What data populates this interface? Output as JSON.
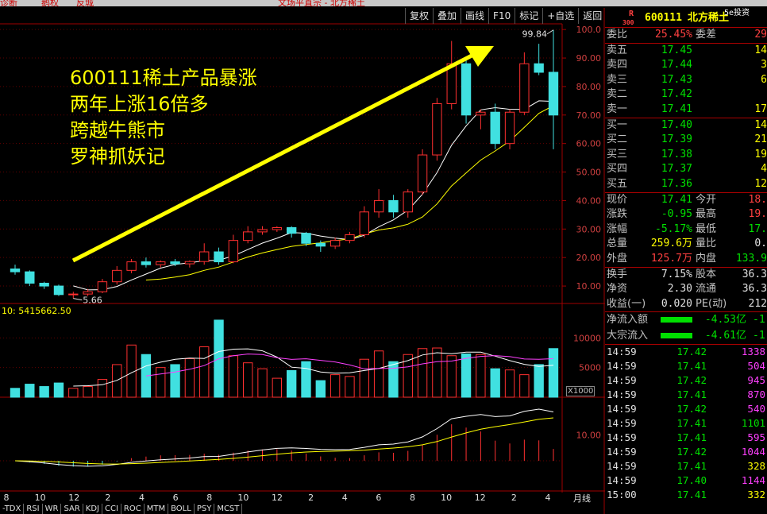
{
  "top_strip": {
    "items": [
      "诊断",
      "鹅权",
      "反城",
      "文场平直宗 - 北方稀土"
    ]
  },
  "toolbar": [
    "复权",
    "叠加",
    "画线",
    "F10",
    "标记",
    "+自选",
    "返回"
  ],
  "headline": [
    "600111稀土产品暴涨",
    "两年上涨16倍多",
    "跨越牛熊市",
    "罗神抓妖记"
  ],
  "price_axis": [
    "100.0",
    "90.00",
    "80.00",
    "70.00",
    "60.00",
    "50.00",
    "40.00",
    "30.00",
    "20.00",
    "10.00"
  ],
  "annotations": {
    "high": "99.84",
    "low": "5.66"
  },
  "volume": {
    "label": "10: 5415662.50",
    "ticks": [
      "10000",
      "5000"
    ],
    "multiplier": "X1000"
  },
  "indicator_ticks": [
    "10.00"
  ],
  "x_ticks": [
    "8",
    "10",
    "12",
    "2",
    "4",
    "6",
    "8",
    "10",
    "12",
    "2",
    "4",
    "6",
    "8",
    "10",
    "12",
    "2",
    "4"
  ],
  "period": "月线",
  "bottom_tabs": [
    "-TDX",
    "RSI",
    "WR",
    "SAR",
    "KDJ",
    "CCI",
    "ROC",
    "MTM",
    "BOLL",
    "PSY",
    "MCST"
  ],
  "stock": {
    "code": "600111",
    "name": "北方稀土",
    "badge_top": "R",
    "badge_bottom": "300",
    "logo": "5e投资"
  },
  "weibi": {
    "label": "委比",
    "value": "25.45%",
    "label2": "委差",
    "value2": "29"
  },
  "asks": [
    {
      "label": "卖五",
      "price": "17.45",
      "vol": "14"
    },
    {
      "label": "卖四",
      "price": "17.44",
      "vol": "3"
    },
    {
      "label": "卖三",
      "price": "17.43",
      "vol": "6"
    },
    {
      "label": "卖二",
      "price": "17.42",
      "vol": ""
    },
    {
      "label": "卖一",
      "price": "17.41",
      "vol": "17"
    }
  ],
  "bids": [
    {
      "label": "买一",
      "price": "17.40",
      "vol": "14"
    },
    {
      "label": "买二",
      "price": "17.39",
      "vol": "21"
    },
    {
      "label": "买三",
      "price": "17.38",
      "vol": "19"
    },
    {
      "label": "买四",
      "price": "17.37",
      "vol": "4"
    },
    {
      "label": "买五",
      "price": "17.36",
      "vol": "12"
    }
  ],
  "quote": [
    {
      "l1": "现价",
      "v1": "17.41",
      "c1": "g",
      "l2": "今开",
      "v2": "18.",
      "c2": "r"
    },
    {
      "l1": "涨跌",
      "v1": "-0.95",
      "c1": "g",
      "l2": "最高",
      "v2": "19.",
      "c2": "r"
    },
    {
      "l1": "涨幅",
      "v1": "-5.17%",
      "c1": "g",
      "l2": "最低",
      "v2": "17.",
      "c2": "g"
    },
    {
      "l1": "总量",
      "v1": "259.6万",
      "c1": "y",
      "l2": "量比",
      "v2": "0.",
      "c2": "w"
    },
    {
      "l1": "外盘",
      "v1": "125.7万",
      "c1": "r",
      "l2": "内盘",
      "v2": "133.9",
      "c2": "g"
    }
  ],
  "stats": [
    {
      "l1": "换手",
      "v1": "7.15%",
      "l2": "股本",
      "v2": "36.3"
    },
    {
      "l1": "净资",
      "v1": "2.30",
      "l2": "流通",
      "v2": "36.3"
    },
    {
      "l1": "收益(一)",
      "v1": "0.020",
      "l2": "PE(动)",
      "v2": "212"
    }
  ],
  "flows": [
    {
      "label": "净流入额",
      "value": "-4.53亿",
      "extra": "-1("
    },
    {
      "label": "大宗流入",
      "value": "-4.61亿",
      "extra": "-1("
    }
  ],
  "ticks": [
    {
      "time": "14:59",
      "price": "17.42",
      "vol": "1338",
      "c": "m"
    },
    {
      "time": "14:59",
      "price": "17.41",
      "vol": "504",
      "c": "m"
    },
    {
      "time": "14:59",
      "price": "17.42",
      "vol": "945",
      "c": "m"
    },
    {
      "time": "14:59",
      "price": "17.41",
      "vol": "870",
      "c": "m"
    },
    {
      "time": "14:59",
      "price": "17.42",
      "vol": "540",
      "c": "m"
    },
    {
      "time": "14:59",
      "price": "17.41",
      "vol": "1101",
      "c": "g"
    },
    {
      "time": "14:59",
      "price": "17.41",
      "vol": "595",
      "c": "m"
    },
    {
      "time": "14:59",
      "price": "17.42",
      "vol": "1044",
      "c": "m"
    },
    {
      "time": "14:59",
      "price": "17.41",
      "vol": "328",
      "c": "y"
    },
    {
      "time": "14:59",
      "price": "17.40",
      "vol": "1144",
      "c": "m"
    },
    {
      "time": "15:00",
      "price": "17.41",
      "vol": "332",
      "c": "y"
    }
  ],
  "colors": {
    "up": "#ff3030",
    "down": "#40e0e0",
    "ma5": "#ffffff",
    "ma10": "#ffff00",
    "arrow": "#ffff00"
  },
  "chart_data": {
    "type": "candlestick",
    "period": "月线",
    "candles": [
      {
        "o": 16,
        "h": 17.5,
        "l": 14,
        "c": 15
      },
      {
        "o": 15,
        "h": 15.5,
        "l": 10,
        "c": 11
      },
      {
        "o": 11,
        "h": 11.5,
        "l": 9,
        "c": 10
      },
      {
        "o": 10,
        "h": 10.5,
        "l": 6.5,
        "c": 7
      },
      {
        "o": 7,
        "h": 8,
        "l": 5.66,
        "c": 7.2
      },
      {
        "o": 7.2,
        "h": 9,
        "l": 6.5,
        "c": 8
      },
      {
        "o": 8,
        "h": 12.5,
        "l": 7.5,
        "c": 11.5
      },
      {
        "o": 11.5,
        "h": 17,
        "l": 10.5,
        "c": 15.5
      },
      {
        "o": 15.5,
        "h": 19.5,
        "l": 14.5,
        "c": 18.5
      },
      {
        "o": 18.5,
        "h": 20,
        "l": 16.5,
        "c": 17.5
      },
      {
        "o": 17.5,
        "h": 19,
        "l": 16.5,
        "c": 18.5
      },
      {
        "o": 18.5,
        "h": 19.5,
        "l": 17,
        "c": 17.8
      },
      {
        "o": 17.8,
        "h": 19,
        "l": 16.5,
        "c": 18.6
      },
      {
        "o": 18.6,
        "h": 25,
        "l": 17.5,
        "c": 22
      },
      {
        "o": 22,
        "h": 23.5,
        "l": 17.5,
        "c": 18.5
      },
      {
        "o": 18.5,
        "h": 28,
        "l": 18,
        "c": 26
      },
      {
        "o": 26,
        "h": 31,
        "l": 25,
        "c": 29
      },
      {
        "o": 29,
        "h": 31,
        "l": 28,
        "c": 29.8
      },
      {
        "o": 29.8,
        "h": 31,
        "l": 29,
        "c": 30.5
      },
      {
        "o": 30.5,
        "h": 31,
        "l": 27,
        "c": 28.5
      },
      {
        "o": 28.5,
        "h": 29,
        "l": 24,
        "c": 25
      },
      {
        "o": 25,
        "h": 26,
        "l": 22,
        "c": 24
      },
      {
        "o": 24,
        "h": 27,
        "l": 23,
        "c": 26
      },
      {
        "o": 26,
        "h": 29,
        "l": 25,
        "c": 28
      },
      {
        "o": 28,
        "h": 38,
        "l": 27,
        "c": 36
      },
      {
        "o": 36,
        "h": 44,
        "l": 34,
        "c": 40
      },
      {
        "o": 40,
        "h": 42,
        "l": 34,
        "c": 36
      },
      {
        "o": 36,
        "h": 44,
        "l": 34,
        "c": 43
      },
      {
        "o": 43,
        "h": 58,
        "l": 42,
        "c": 56
      },
      {
        "o": 56,
        "h": 76,
        "l": 54,
        "c": 74
      },
      {
        "o": 74,
        "h": 96,
        "l": 72,
        "c": 88
      },
      {
        "o": 88,
        "h": 90,
        "l": 67,
        "c": 70
      },
      {
        "o": 70,
        "h": 72,
        "l": 65,
        "c": 71
      },
      {
        "o": 71,
        "h": 74,
        "l": 58,
        "c": 60
      },
      {
        "o": 60,
        "h": 72,
        "l": 58,
        "c": 71
      },
      {
        "o": 71,
        "h": 92,
        "l": 70,
        "c": 88
      },
      {
        "o": 88,
        "h": 95,
        "l": 84,
        "c": 85
      },
      {
        "o": 85,
        "h": 99.84,
        "l": 58,
        "c": 70
      }
    ],
    "volume": [
      1500,
      2200,
      1800,
      2400,
      1500,
      1800,
      3000,
      5500,
      8800,
      7200,
      5000,
      5500,
      6500,
      8500,
      13000,
      7000,
      5800,
      4800,
      3200,
      4500,
      6000,
      2800,
      3800,
      3500,
      6400,
      7800,
      6000,
      7200,
      8200,
      8300,
      7000,
      7300,
      7200,
      4800,
      4600,
      3800,
      5500,
      8200
    ],
    "ylim_price": [
      5,
      102
    ],
    "ylim_volume": [
      0,
      15000
    ]
  }
}
